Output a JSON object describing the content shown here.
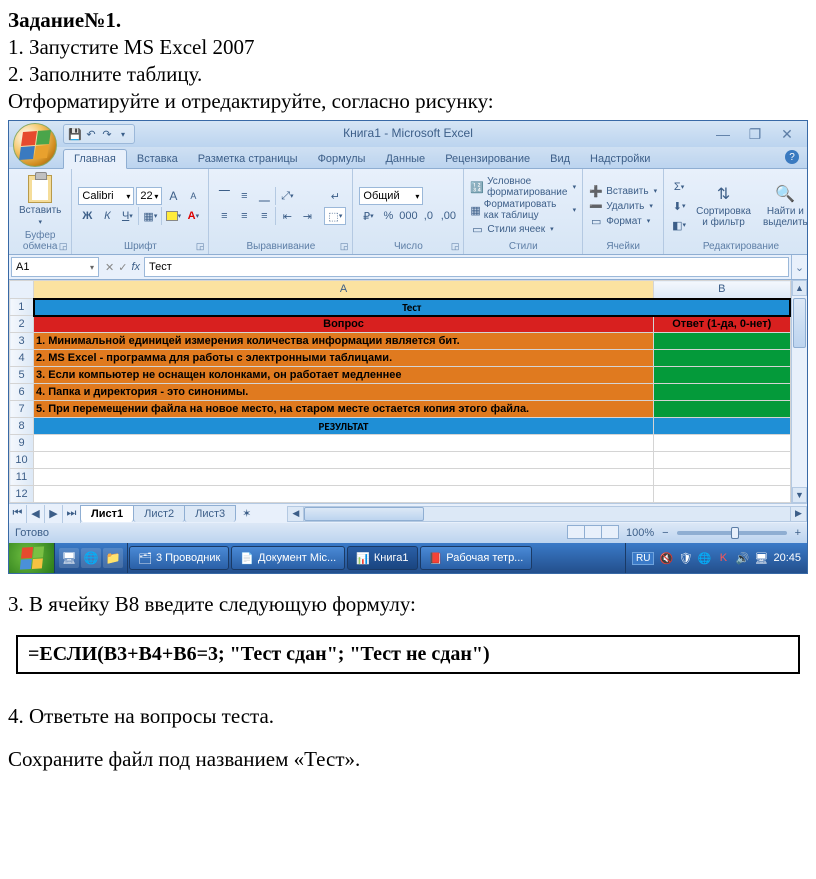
{
  "doc": {
    "task_header": "Задание№1.",
    "step1": "1. Запустите MS Excel 2007",
    "step2": "2. Заполните таблицу.",
    "step2b": "Отформатируйте и отредактируйте, согласно рисунку:",
    "step3": "3. В ячейку B8 введите следующую формулу:",
    "formula": "=ЕСЛИ(B3+B4+B6=3; \"Тест сдан\"; \"Тест не сдан\")",
    "step4": "4. Ответьте на вопросы теста.",
    "step5": "Сохраните файл под названием «Тест»."
  },
  "excel": {
    "title": "Книга1 - Microsoft Excel",
    "tabs": [
      "Главная",
      "Вставка",
      "Разметка страницы",
      "Формулы",
      "Данные",
      "Рецензирование",
      "Вид",
      "Надстройки"
    ],
    "active_tab": 0,
    "groups": {
      "clipboard": "Буфер обмена",
      "paste": "Вставить",
      "font": "Шрифт",
      "alignment": "Выравнивание",
      "number": "Число",
      "styles": "Стили",
      "cells": "Ячейки",
      "editing": "Редактирование"
    },
    "font": {
      "name": "Calibri",
      "size": "22"
    },
    "number_format": "Общий",
    "styles_items": {
      "cond": "Условное форматирование",
      "table": "Форматировать как таблицу",
      "cell": "Стили ячеек"
    },
    "cells_items": {
      "insert": "Вставить",
      "delete": "Удалить",
      "format": "Формат"
    },
    "editing_items": {
      "sort": "Сортировка и фильтр",
      "find": "Найти и выделить"
    },
    "namebox": "A1",
    "formula_value": "Тест",
    "columns": [
      "A",
      "B"
    ],
    "rows": [
      {
        "n": 1,
        "type": "title",
        "a": "Тест",
        "b": ""
      },
      {
        "n": 2,
        "type": "header",
        "a": "Вопрос",
        "b": "Ответ (1-да, 0-нет)"
      },
      {
        "n": 3,
        "type": "q",
        "a": "1. Минимальной единицей измерения количества информации является бит.",
        "b": ""
      },
      {
        "n": 4,
        "type": "q",
        "a": "2. MS Excel - программа для работы с электронными таблицами.",
        "b": ""
      },
      {
        "n": 5,
        "type": "q",
        "a": "3. Если компьютер не оснащен колонками, он работает медленнее",
        "b": ""
      },
      {
        "n": 6,
        "type": "q",
        "a": "4. Папка и директория - это синонимы.",
        "b": ""
      },
      {
        "n": 7,
        "type": "q",
        "a": "5. При перемещении файла на новое место, на старом месте остается копия этого файла.",
        "b": ""
      },
      {
        "n": 8,
        "type": "result",
        "a": "РЕЗУЛЬТАТ",
        "b": ""
      },
      {
        "n": 9,
        "type": "empty"
      },
      {
        "n": 10,
        "type": "empty"
      },
      {
        "n": 11,
        "type": "empty"
      },
      {
        "n": 12,
        "type": "empty"
      }
    ],
    "sheet_tabs": [
      "Лист1",
      "Лист2",
      "Лист3"
    ],
    "active_sheet": 0,
    "status": "Готово",
    "zoom": "100%"
  },
  "taskbar": {
    "buttons": [
      {
        "icon": "🗂",
        "label": "3 Проводник"
      },
      {
        "icon": "📄",
        "label": "Документ Mic..."
      },
      {
        "icon": "📊",
        "label": "Книга1"
      },
      {
        "icon": "📕",
        "label": "Рабочая тетр..."
      }
    ],
    "lang": "RU",
    "time": "20:45"
  }
}
